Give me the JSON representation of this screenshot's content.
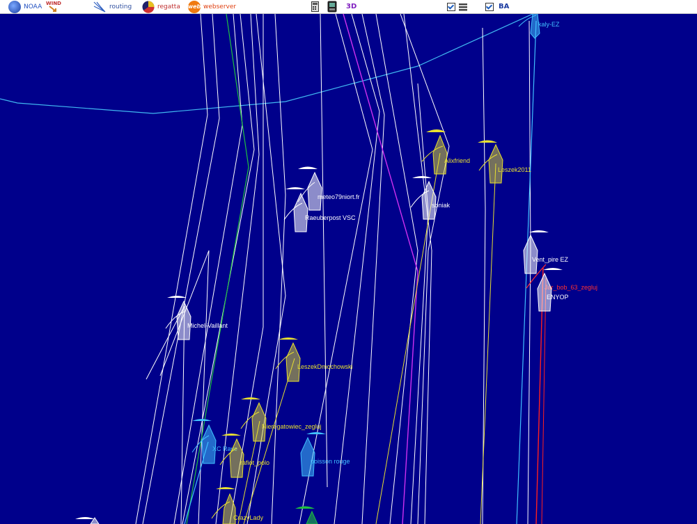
{
  "toolbar": {
    "noaa_label": "NOAA",
    "wind_label": "WIND",
    "routing_label": "routing",
    "regatta_label": "regatta",
    "webserver_label": "webserver",
    "view3d_label": "3D",
    "ba_label": "BA",
    "webserver_icon_text": "web"
  },
  "boats": [
    {
      "name": "kaly-EZ",
      "color": "#40c0ff"
    },
    {
      "name": "Alixfriend",
      "color": "#e8e830"
    },
    {
      "name": "Leszek2011",
      "color": "#e8e830"
    },
    {
      "name": "meteo79niort.fr",
      "color": "#ffffff"
    },
    {
      "name": "Raeuberpost VSC",
      "color": "#ffffff"
    },
    {
      "name": "soniak",
      "color": "#ffffff"
    },
    {
      "name": "Vent_pire EZ",
      "color": "#ffffff"
    },
    {
      "name": "Jar_bob_63_zegluj",
      "color": "#ff3030"
    },
    {
      "name": "ENYOP",
      "color": "#ffffff"
    },
    {
      "name": "Michel-Vaillant",
      "color": "#ffffff"
    },
    {
      "name": "LeszekDmochowski",
      "color": "#e8e830"
    },
    {
      "name": "Nieregatowiec_zegluj",
      "color": "#e8e830"
    },
    {
      "name": "XC Rave",
      "color": "#40c0ff"
    },
    {
      "name": "rafiot_polo",
      "color": "#e8e830"
    },
    {
      "name": "poisson rouge",
      "color": "#40c0ff"
    },
    {
      "name": "CrazyLady",
      "color": "#e8e830"
    }
  ]
}
